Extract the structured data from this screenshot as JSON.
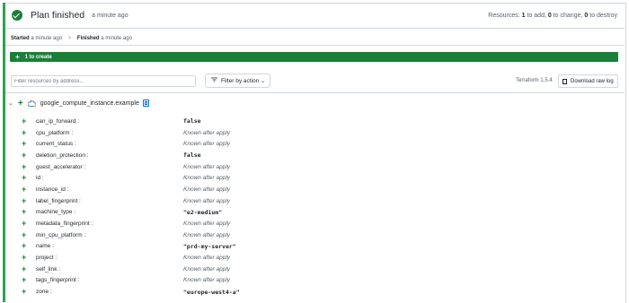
{
  "header": {
    "title": "Plan finished",
    "ago": "a minute ago",
    "resources": {
      "prefix": "Resources:",
      "add_count": "1",
      "add_label": "to add,",
      "change_count": "0",
      "change_label": "to change,",
      "destroy_count": "0",
      "destroy_label": "to destroy"
    }
  },
  "timing": {
    "started_label": "Started",
    "started_ago": "a minute ago",
    "separator": ">",
    "finished_label": "Finished",
    "finished_ago": "a minute ago"
  },
  "summary_bar": {
    "label": "1 to create",
    "color": "#1a7f37"
  },
  "toolbar": {
    "search_placeholder": "Filter resources by address...",
    "filter_label": "Filter by action",
    "terraform_version": "Terraform 1.5.4",
    "download_label": "Download raw log"
  },
  "resource": {
    "address": "google_compute_instance.example",
    "icon": "google-cloud-icon",
    "attributes": [
      {
        "key": "can_ip_forward :",
        "value": "false",
        "literal": true
      },
      {
        "key": "cpu_platform :",
        "value": "Known after apply",
        "literal": false
      },
      {
        "key": "current_status :",
        "value": "Known after apply",
        "literal": false
      },
      {
        "key": "deletion_protection :",
        "value": "false",
        "literal": true
      },
      {
        "key": "guest_accelerator :",
        "value": "Known after apply",
        "literal": false
      },
      {
        "key": "id :",
        "value": "Known after apply",
        "literal": false
      },
      {
        "key": "instance_id :",
        "value": "Known after apply",
        "literal": false
      },
      {
        "key": "label_fingerprint :",
        "value": "Known after apply",
        "literal": false
      },
      {
        "key": "machine_type :",
        "value": "\"e2-medium\"",
        "literal": true
      },
      {
        "key": "metadata_fingerprint :",
        "value": "Known after apply",
        "literal": false
      },
      {
        "key": "min_cpu_platform :",
        "value": "Known after apply",
        "literal": false
      },
      {
        "key": "name :",
        "value": "\"prd-my-server\"",
        "literal": true
      },
      {
        "key": "project :",
        "value": "Known after apply",
        "literal": false
      },
      {
        "key": "self_link :",
        "value": "Known after apply",
        "literal": false
      },
      {
        "key": "tags_fingerprint :",
        "value": "Known after apply",
        "literal": false
      },
      {
        "key": "zone :",
        "value": "\"europe-west4-a\"",
        "literal": true
      }
    ]
  }
}
